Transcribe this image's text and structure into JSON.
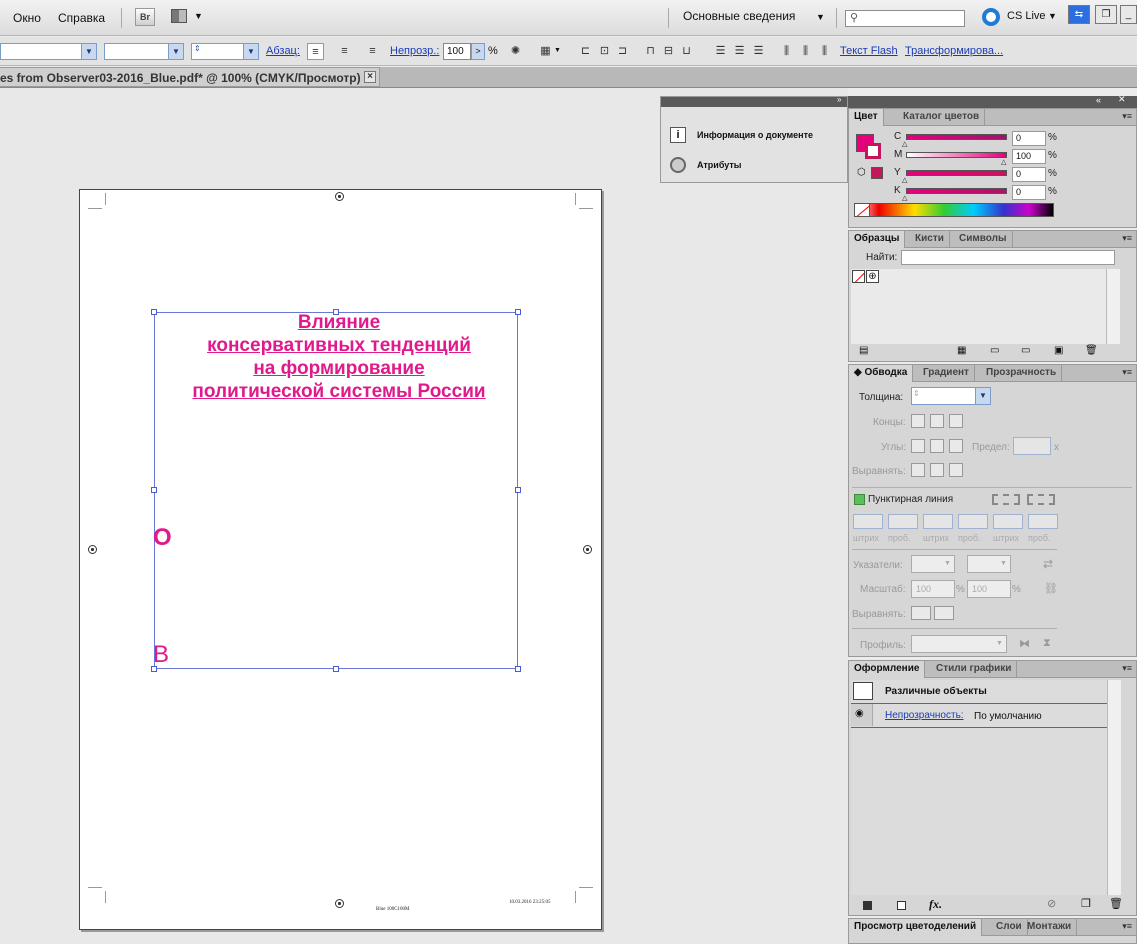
{
  "menubar": {
    "items": [
      "Окно",
      "Справка"
    ],
    "bridge_label": "Br",
    "workspace": "Основные сведения",
    "cslive": "CS Live"
  },
  "control": {
    "paragraph_label": "Абзац:",
    "opacity_label": "Непрозр.:",
    "opacity_value": "100",
    "percent": "%",
    "flash_text": "Текст Flash",
    "transform": "Трансформирова..."
  },
  "document_tab": {
    "title": "es from Observer03-2016_Blue.pdf* @ 100% (CMYK/Просмотр)",
    "close": "×"
  },
  "artboard": {
    "headline": [
      "Влияние",
      "консервативных тенденций",
      "на формирование",
      "политической системы России"
    ],
    "letter1": "О",
    "letter2": "В",
    "footer_mid": "Blue 100C100M",
    "footer_right": "10.03.2016   23:25:05"
  },
  "docinfo_panel": {
    "items": [
      "Информация о документе",
      "Атрибуты"
    ]
  },
  "color_panel": {
    "tabs": [
      "Цвет",
      "Каталог цветов"
    ],
    "channels": [
      {
        "name": "C",
        "value": "0",
        "color": "#a1126b"
      },
      {
        "name": "M",
        "value": "100",
        "color": "#ffffff"
      },
      {
        "name": "Y",
        "value": "0",
        "color": "#cc1060"
      },
      {
        "name": "K",
        "value": "0",
        "color": "#b0126a"
      }
    ],
    "percent": "%",
    "fill_color": "#e6007e"
  },
  "swatches_panel": {
    "tabs": [
      "Образцы",
      "Кисти",
      "Символы"
    ],
    "find_label": "Найти:"
  },
  "stroke_panel": {
    "tabs": [
      "Обводка",
      "Градиент",
      "Прозрачность"
    ],
    "weight_label": "Толщина:",
    "caps_label": "Концы:",
    "corners_label": "Углы:",
    "limit_label": "Предел:",
    "align_label": "Выравнять:",
    "dashed_label": "Пунктирная линия",
    "dash_labels": [
      "штрих",
      "проб.",
      "штрих",
      "проб.",
      "штрих",
      "проб."
    ],
    "arrowheads_label": "Указатели:",
    "scale_label": "Масштаб:",
    "scale_values": [
      "100",
      "100"
    ],
    "align2_label": "Выравнять:",
    "profile_label": "Профиль:",
    "x_mark": "x",
    "percent": "%"
  },
  "appearance_panel": {
    "tabs": [
      "Оформление",
      "Стили графики"
    ],
    "title": "Различные объекты",
    "opacity_link": "Непрозрачность:",
    "opacity_value": "По умолчанию",
    "fx": "fx."
  },
  "bottom_panel": {
    "tabs": [
      "Просмотр цветоделений",
      "Слои",
      "Монтажи"
    ]
  }
}
